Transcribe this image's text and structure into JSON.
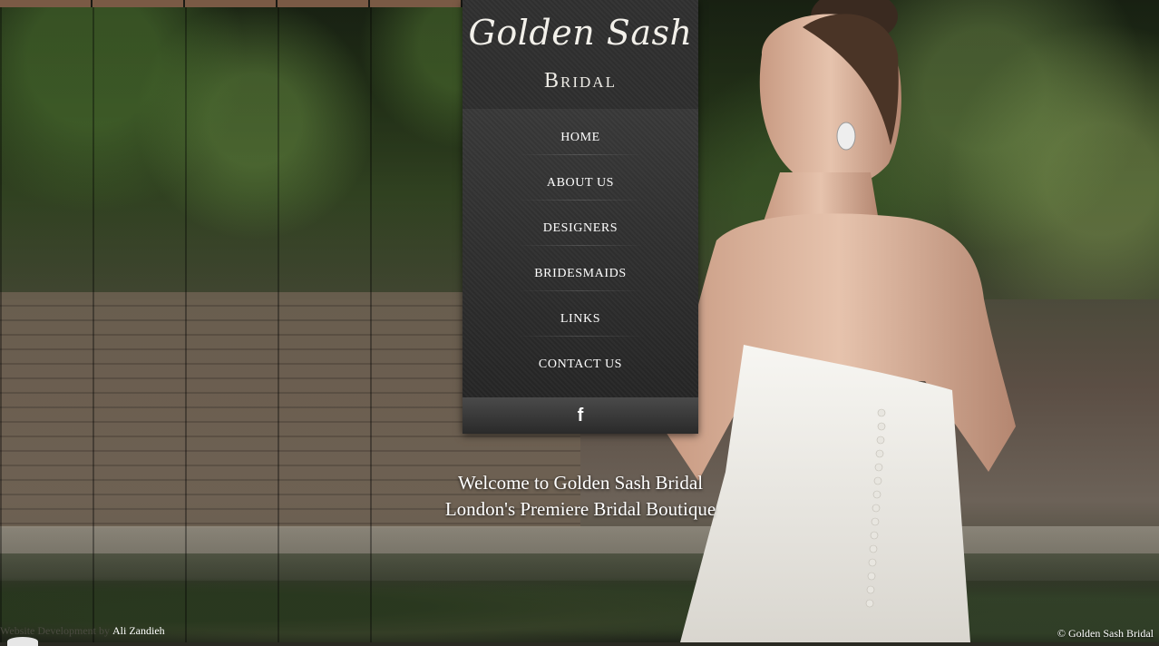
{
  "brand": {
    "script_name": "Golden Sash",
    "sub_name": "Bridal"
  },
  "nav": {
    "items": [
      {
        "label": "HOME"
      },
      {
        "label": "ABOUT US"
      },
      {
        "label": "DESIGNERS"
      },
      {
        "label": "BRIDESMAIDS"
      },
      {
        "label": "LINKS"
      },
      {
        "label": "CONTACT US"
      }
    ]
  },
  "social": {
    "facebook_glyph": "f",
    "icon": "facebook-icon"
  },
  "welcome": {
    "line1": "Welcome to Golden Sash Bridal",
    "line2": "London's Premiere Bridal Boutique"
  },
  "footer": {
    "credit_prefix": "Website Development by",
    "credit_name": "Ali Zandieh",
    "copyright": "© Golden Sash Bridal"
  },
  "colors": {
    "panel": "#2b2b2b",
    "text": "#ffffff"
  }
}
